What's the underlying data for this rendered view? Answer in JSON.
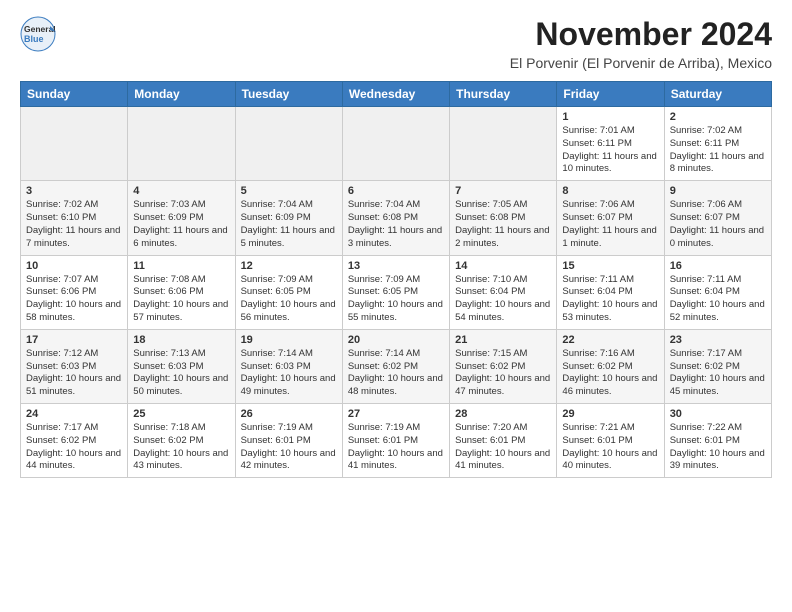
{
  "header": {
    "logo_general": "General",
    "logo_blue": "Blue",
    "month_title": "November 2024",
    "location": "El Porvenir (El Porvenir de Arriba), Mexico"
  },
  "weekdays": [
    "Sunday",
    "Monday",
    "Tuesday",
    "Wednesday",
    "Thursday",
    "Friday",
    "Saturday"
  ],
  "weeks": [
    [
      {
        "day": "",
        "detail": ""
      },
      {
        "day": "",
        "detail": ""
      },
      {
        "day": "",
        "detail": ""
      },
      {
        "day": "",
        "detail": ""
      },
      {
        "day": "",
        "detail": ""
      },
      {
        "day": "1",
        "detail": "Sunrise: 7:01 AM\nSunset: 6:11 PM\nDaylight: 11 hours\nand 10 minutes."
      },
      {
        "day": "2",
        "detail": "Sunrise: 7:02 AM\nSunset: 6:11 PM\nDaylight: 11 hours\nand 8 minutes."
      }
    ],
    [
      {
        "day": "3",
        "detail": "Sunrise: 7:02 AM\nSunset: 6:10 PM\nDaylight: 11 hours\nand 7 minutes."
      },
      {
        "day": "4",
        "detail": "Sunrise: 7:03 AM\nSunset: 6:09 PM\nDaylight: 11 hours\nand 6 minutes."
      },
      {
        "day": "5",
        "detail": "Sunrise: 7:04 AM\nSunset: 6:09 PM\nDaylight: 11 hours\nand 5 minutes."
      },
      {
        "day": "6",
        "detail": "Sunrise: 7:04 AM\nSunset: 6:08 PM\nDaylight: 11 hours\nand 3 minutes."
      },
      {
        "day": "7",
        "detail": "Sunrise: 7:05 AM\nSunset: 6:08 PM\nDaylight: 11 hours\nand 2 minutes."
      },
      {
        "day": "8",
        "detail": "Sunrise: 7:06 AM\nSunset: 6:07 PM\nDaylight: 11 hours\nand 1 minute."
      },
      {
        "day": "9",
        "detail": "Sunrise: 7:06 AM\nSunset: 6:07 PM\nDaylight: 11 hours\nand 0 minutes."
      }
    ],
    [
      {
        "day": "10",
        "detail": "Sunrise: 7:07 AM\nSunset: 6:06 PM\nDaylight: 10 hours\nand 58 minutes."
      },
      {
        "day": "11",
        "detail": "Sunrise: 7:08 AM\nSunset: 6:06 PM\nDaylight: 10 hours\nand 57 minutes."
      },
      {
        "day": "12",
        "detail": "Sunrise: 7:09 AM\nSunset: 6:05 PM\nDaylight: 10 hours\nand 56 minutes."
      },
      {
        "day": "13",
        "detail": "Sunrise: 7:09 AM\nSunset: 6:05 PM\nDaylight: 10 hours\nand 55 minutes."
      },
      {
        "day": "14",
        "detail": "Sunrise: 7:10 AM\nSunset: 6:04 PM\nDaylight: 10 hours\nand 54 minutes."
      },
      {
        "day": "15",
        "detail": "Sunrise: 7:11 AM\nSunset: 6:04 PM\nDaylight: 10 hours\nand 53 minutes."
      },
      {
        "day": "16",
        "detail": "Sunrise: 7:11 AM\nSunset: 6:04 PM\nDaylight: 10 hours\nand 52 minutes."
      }
    ],
    [
      {
        "day": "17",
        "detail": "Sunrise: 7:12 AM\nSunset: 6:03 PM\nDaylight: 10 hours\nand 51 minutes."
      },
      {
        "day": "18",
        "detail": "Sunrise: 7:13 AM\nSunset: 6:03 PM\nDaylight: 10 hours\nand 50 minutes."
      },
      {
        "day": "19",
        "detail": "Sunrise: 7:14 AM\nSunset: 6:03 PM\nDaylight: 10 hours\nand 49 minutes."
      },
      {
        "day": "20",
        "detail": "Sunrise: 7:14 AM\nSunset: 6:02 PM\nDaylight: 10 hours\nand 48 minutes."
      },
      {
        "day": "21",
        "detail": "Sunrise: 7:15 AM\nSunset: 6:02 PM\nDaylight: 10 hours\nand 47 minutes."
      },
      {
        "day": "22",
        "detail": "Sunrise: 7:16 AM\nSunset: 6:02 PM\nDaylight: 10 hours\nand 46 minutes."
      },
      {
        "day": "23",
        "detail": "Sunrise: 7:17 AM\nSunset: 6:02 PM\nDaylight: 10 hours\nand 45 minutes."
      }
    ],
    [
      {
        "day": "24",
        "detail": "Sunrise: 7:17 AM\nSunset: 6:02 PM\nDaylight: 10 hours\nand 44 minutes."
      },
      {
        "day": "25",
        "detail": "Sunrise: 7:18 AM\nSunset: 6:02 PM\nDaylight: 10 hours\nand 43 minutes."
      },
      {
        "day": "26",
        "detail": "Sunrise: 7:19 AM\nSunset: 6:01 PM\nDaylight: 10 hours\nand 42 minutes."
      },
      {
        "day": "27",
        "detail": "Sunrise: 7:19 AM\nSunset: 6:01 PM\nDaylight: 10 hours\nand 41 minutes."
      },
      {
        "day": "28",
        "detail": "Sunrise: 7:20 AM\nSunset: 6:01 PM\nDaylight: 10 hours\nand 41 minutes."
      },
      {
        "day": "29",
        "detail": "Sunrise: 7:21 AM\nSunset: 6:01 PM\nDaylight: 10 hours\nand 40 minutes."
      },
      {
        "day": "30",
        "detail": "Sunrise: 7:22 AM\nSunset: 6:01 PM\nDaylight: 10 hours\nand 39 minutes."
      }
    ]
  ]
}
